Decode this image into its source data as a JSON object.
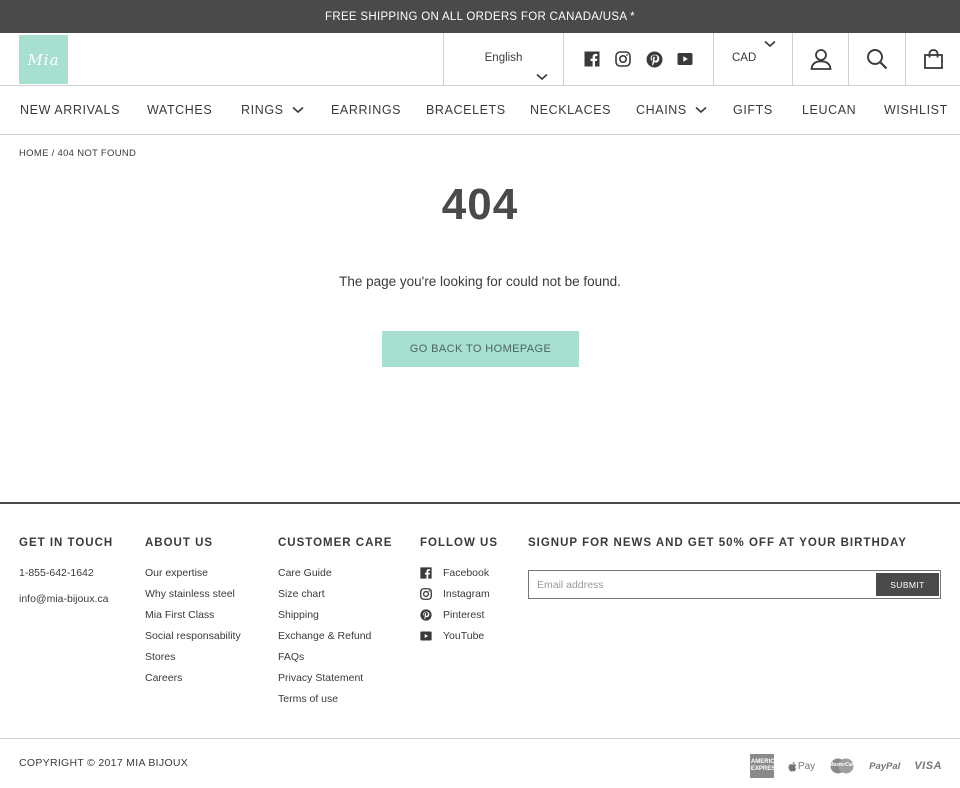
{
  "announcement": "FREE SHIPPING ON ALL ORDERS FOR CANADA/USA *",
  "logo_text": "Mia",
  "header": {
    "language": "English",
    "currency": "CAD",
    "social_icons": [
      "facebook-icon",
      "instagram-icon",
      "pinterest-icon",
      "youtube-icon"
    ],
    "icons": [
      "user-icon",
      "search-icon",
      "shopping-bag-icon"
    ]
  },
  "nav": [
    {
      "label": "NEW ARRIVALS"
    },
    {
      "label": "WATCHES"
    },
    {
      "label": "RINGS"
    },
    {
      "label": "EARRINGS"
    },
    {
      "label": "BRACELETS"
    },
    {
      "label": "NECKLACES"
    },
    {
      "label": "CHAINS"
    },
    {
      "label": "GIFTS"
    },
    {
      "label": "LEUCAN"
    },
    {
      "label": "WISHLIST"
    }
  ],
  "breadcrumb": "HOME / 404 NOT FOUND",
  "error": {
    "code": "404",
    "message": "The page you're looking for could not be found.",
    "button": "GO BACK TO HOMEPAGE"
  },
  "footer": {
    "contact": {
      "heading": "GET IN TOUCH",
      "phone": "1-855-642-1642",
      "email": "info@mia-bijoux.ca"
    },
    "about": {
      "heading": "ABOUT US",
      "links": [
        "Our expertise",
        "Why stainless steel",
        "Mia First Class",
        "Social responsability",
        "Stores",
        "Careers"
      ]
    },
    "care": {
      "heading": "CUSTOMER CARE",
      "links": [
        "Care Guide",
        "Size chart",
        "Shipping",
        "Exchange & Refund",
        "FAQs",
        "Privacy Statement",
        "Terms of use"
      ]
    },
    "follow": {
      "heading": "FOLLOW US",
      "links": [
        "Facebook",
        "Instagram",
        "Pinterest",
        "YouTube"
      ]
    },
    "signup": {
      "heading": "SIGNUP FOR NEWS AND GET 50% OFF AT YOUR BIRTHDAY",
      "placeholder": "Email address",
      "button": "SUBMIT"
    }
  },
  "copyright": "COPYRIGHT © 2017 MIA BIJOUX",
  "payments": {
    "amex": "AMERICAN EXPRESS",
    "applepay": "Pay",
    "mastercard": "MasterCard",
    "paypal": "PayPal",
    "visa": "VISA"
  },
  "colors": {
    "accent": "#a7dfd0",
    "dark": "#4a4a4a"
  }
}
